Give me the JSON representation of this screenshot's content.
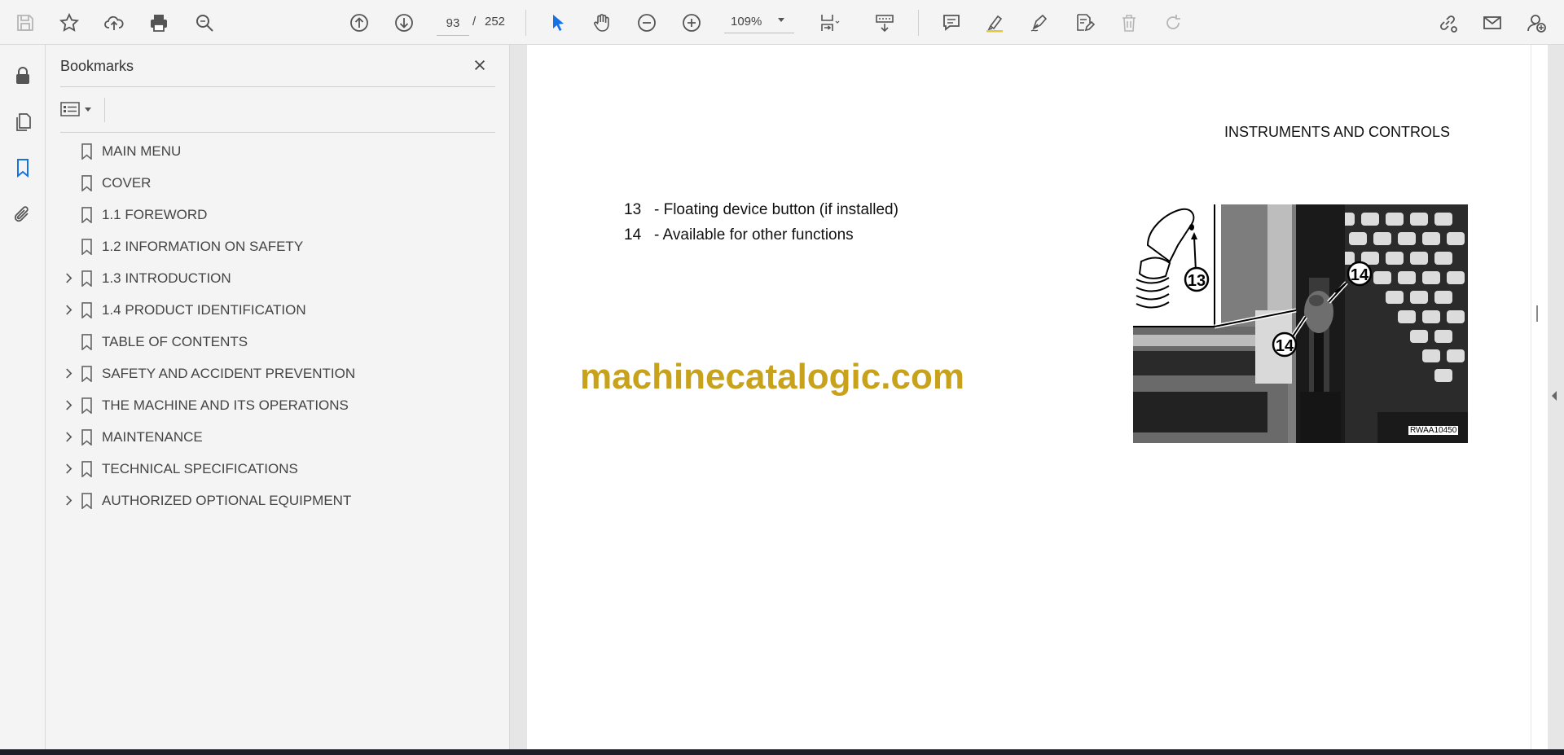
{
  "toolbar": {
    "page_current": "93",
    "page_separator": "/",
    "page_total": "252",
    "zoom": "109%"
  },
  "colors": {
    "accent": "#1473e6",
    "watermark": "#c9a21b",
    "chrome_bg": "#f4f4f4"
  },
  "panel": {
    "title": "Bookmarks",
    "bookmarks": [
      {
        "label": "MAIN MENU",
        "expandable": false
      },
      {
        "label": "COVER",
        "expandable": false
      },
      {
        "label": "1.1 FOREWORD",
        "expandable": false
      },
      {
        "label": "1.2 INFORMATION ON SAFETY",
        "expandable": false
      },
      {
        "label": "1.3 INTRODUCTION",
        "expandable": true
      },
      {
        "label": "1.4 PRODUCT IDENTIFICATION",
        "expandable": true
      },
      {
        "label": "TABLE OF CONTENTS",
        "expandable": false
      },
      {
        "label": "SAFETY AND ACCIDENT PREVENTION",
        "expandable": true
      },
      {
        "label": "THE MACHINE AND ITS OPERATIONS",
        "expandable": true
      },
      {
        "label": "MAINTENANCE",
        "expandable": true
      },
      {
        "label": "TECHNICAL SPECIFICATIONS",
        "expandable": true
      },
      {
        "label": "AUTHORIZED OPTIONAL EQUIPMENT",
        "expandable": true
      }
    ]
  },
  "document": {
    "header": "INSTRUMENTS AND CONTROLS",
    "items": [
      {
        "number": "13",
        "text": "- Floating device button (if installed)"
      },
      {
        "number": "14",
        "text": "- Available for other functions"
      }
    ],
    "watermark": "machinecatalogic.com",
    "figure_callouts": [
      "13",
      "14",
      "14"
    ],
    "figure_code": "RWAA10450"
  }
}
